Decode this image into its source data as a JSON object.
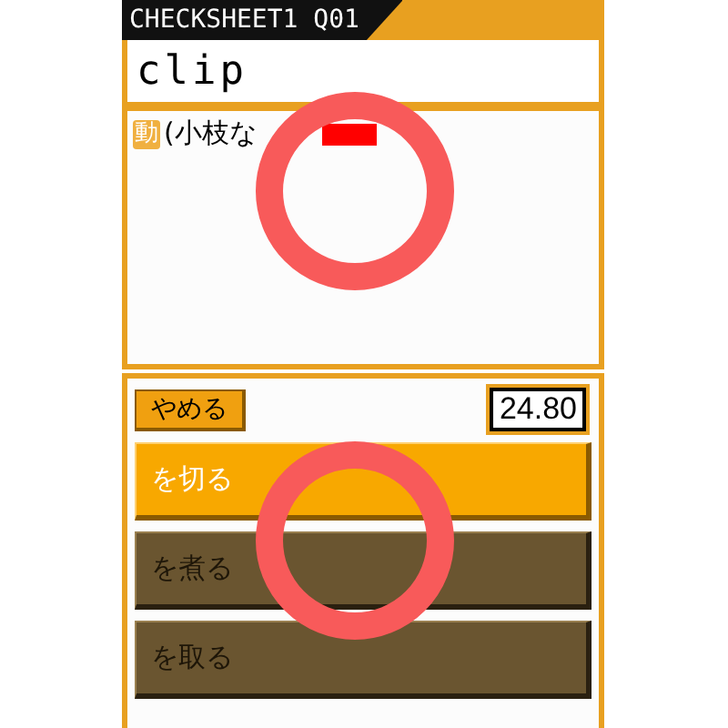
{
  "header": {
    "title": "CHECKSHEET1 Q01"
  },
  "question": {
    "word": "clip"
  },
  "definition": {
    "badge": "動",
    "text": "(小枝な"
  },
  "controls": {
    "quit_button": "やめる",
    "timer": "24.80"
  },
  "choices": [
    {
      "label": "を切る",
      "selected": true
    },
    {
      "label": "を煮る",
      "selected": false
    },
    {
      "label": "を取る",
      "selected": false
    }
  ]
}
